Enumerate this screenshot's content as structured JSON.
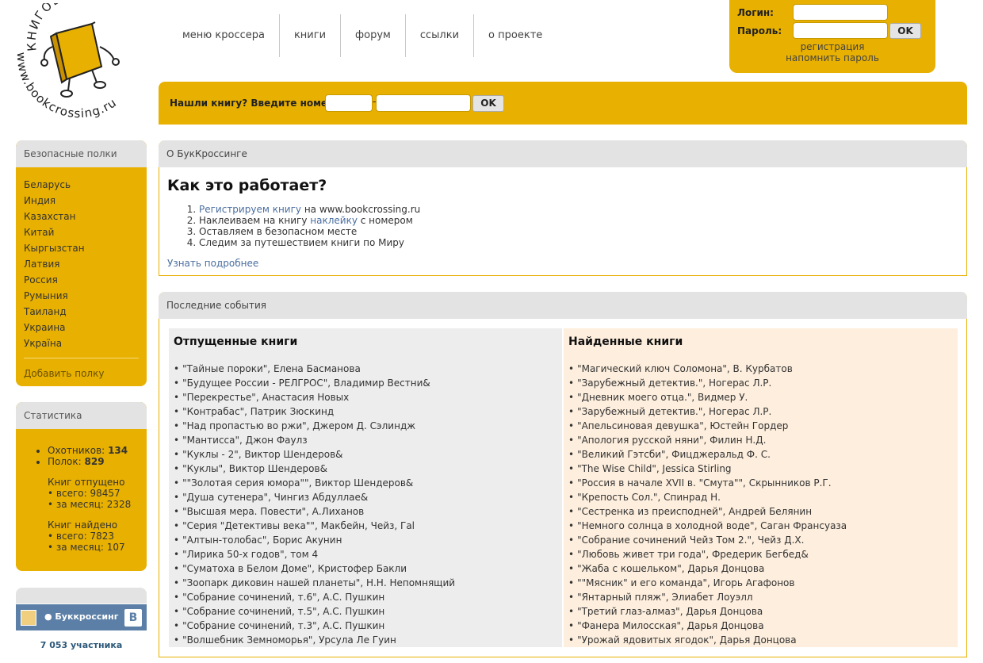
{
  "logo": {
    "title": "КНИГОВОРОТ",
    "url": "www.bookcrossing.ru"
  },
  "nav": {
    "items": [
      "меню кроссера",
      "книги",
      "форум",
      "ссылки",
      "о проекте"
    ]
  },
  "login": {
    "login_label": "Логин:",
    "password_label": "Пароль:",
    "ok_label": "OK",
    "register": "регистрация",
    "remind": "напомнить пароль",
    "login_value": "",
    "password_value": ""
  },
  "findbar": {
    "label": "Нашли книгу? Введите номер:",
    "dash": "-",
    "ok_label": "OK"
  },
  "shelves": {
    "title": "Безопасные полки",
    "items": [
      "Беларусь",
      "Индия",
      "Казахстан",
      "Китай",
      "Кыргызстан",
      "Латвия",
      "Россия",
      "Румыния",
      "Таиланд",
      "Украина",
      "Україна"
    ],
    "add": "Добавить полку"
  },
  "stats": {
    "title": "Статистика",
    "hunters_label": "Охотников:",
    "hunters": "134",
    "shelves_label": "Полок:",
    "shelves": "829",
    "released_title": "Книг отпущено",
    "released_total_label": "всего:",
    "released_total": "98457",
    "released_month_label": "за месяц:",
    "released_month": "2328",
    "found_title": "Книг найдено",
    "found_total_label": "всего:",
    "found_total": "7823",
    "found_month_label": "за месяц:",
    "found_month": "107"
  },
  "vk": {
    "name": "● Буккроссинг",
    "b": "B",
    "members": "7 053 участника"
  },
  "about": {
    "header": "О БукКроссинге",
    "title": "Как это работает?",
    "step1_link": "Регистрируем книгу",
    "step1_rest": " на www.bookcrossing.ru",
    "step2_pre": "Наклеиваем на книгу ",
    "step2_link": "наклейку",
    "step2_rest": " с номером",
    "step3": "Оставляем в безопасном месте",
    "step4": "Следим за путешествием книги по Миру",
    "more": "Узнать подробнее"
  },
  "events": {
    "header": "Последние события",
    "released_title": "Отпущенные книги",
    "found_title": "Найденные книги",
    "released": [
      "\"Тайные пороки\", Елена Басманова",
      "\"Будущее России - РЕЛГРОС\", Владимир Вестни&",
      "\"Перекрестье\", Анастасия Новых",
      "\"Контрабас\", Патрик Зюскинд",
      "\"Над пропастью во ржи\", Джером Д. Сэлиндж",
      "\"Мантисса\", Джон Фаулз",
      "\"Куклы - 2\", Виктор Шендеров&",
      "\"Куклы\", Виктор Шендеров&",
      "\"\"Золотая серия юмора\"\", Виктор Шендеров&",
      "\"Душа сутенера\", Чингиз Абдуллае&",
      "\"Высшая мера. Повести\", А.Лиханов",
      "\"Серия \"Детективы века\"\", Макбейн, Чейз, Гal",
      "\"Алтын-толобас\", Борис Акунин",
      "\"Лирика 50-х годов\", том 4",
      "\"Суматоха в Белом Доме\", Кристофер Бакли",
      "\"Зоопарк диковин нашей планеты\", Н.Н. Непомнящий",
      "\"Собрание сочинений, т.6\", А.С. Пушкин",
      "\"Собрание сочинений, т.5\", А.С. Пушкин",
      "\"Собрание сочинений, т.3\", А.С. Пушкин",
      "\"Волшебник Земноморья\", Урсула Ле Гуин"
    ],
    "found": [
      "\"Магический ключ Соломона\", В. Курбатов",
      "\"Зарубежный детектив.\", Ногерас Л.Р.",
      "\"Дневник моего отца.\", Видмер У.",
      "\"Зарубежный детектив.\", Ногерас Л.Р.",
      "\"Апельсиновая девушка\", Юстейн Гордер",
      "\"Апология русской няни\", Филин Н.Д.",
      "\"Великий Гэтсби\", Фицджеральд Ф. С.",
      "\"The Wise Child\", Jessica Stirling",
      "\"Россия в начале XVII в. \"Смута\"\", Скрынников Р.Г.",
      "\"Крепость Сол.\", Спинрад Н.",
      "\"Сестренка из преисподней\", Андрей Белянин",
      "\"Немного солнца в холодной воде\", Саган Франсуаза",
      "\"Собрание сочинений Чейз Том 2.\", Чейз Д.Х.",
      "\"Любовь живет три года\", Фредерик Бегбед&",
      "\"Жаба с кошельком\", Дарья Донцова",
      "\"\"Мясник\" и его команда\", Игорь Агафонов",
      "\"Янтарный пляж\", Элиабет Лоуэлл",
      "\"Третий глаз-алмаз\", Дарья Донцова",
      "\"Фанера Милосская\", Дарья Донцова",
      "\"Урожай ядовитых ягодок\", Дарья Донцова"
    ]
  }
}
